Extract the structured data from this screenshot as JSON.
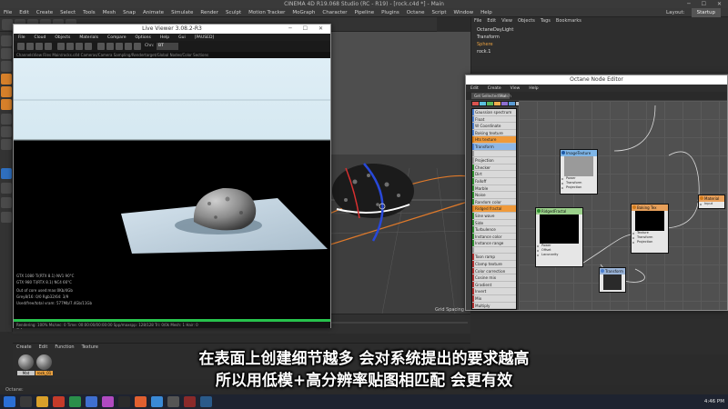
{
  "c4d": {
    "window_title": "CINEMA 4D R19.068 Studio (RC - R19) - [rock.c4d *] - Main",
    "menu": [
      "File",
      "Edit",
      "Create",
      "Select",
      "Tools",
      "Mesh",
      "Snap",
      "Animate",
      "Simulate",
      "Render",
      "Sculpt",
      "Motion Tracker",
      "MoGraph",
      "Character",
      "Pipeline",
      "Plugins",
      "Octane",
      "Script",
      "Window",
      "Help"
    ],
    "layout_label": "Layout:",
    "layout_value": "Startup",
    "object_manager": {
      "menu": [
        "File",
        "Edit",
        "View",
        "Objects",
        "Tags",
        "Bookmarks"
      ],
      "objects": [
        "OctaneDayLight",
        "Transform",
        "Sphere",
        "rock.1"
      ]
    },
    "material_manager": {
      "menu": [
        "Create",
        "Edit",
        "Function",
        "Texture"
      ],
      "materials": [
        "Mat",
        "rock_01"
      ]
    },
    "viewport_hud": "Grid Spacing : 1 m",
    "timeline_frame": "0 F",
    "status_text": "Octane:",
    "clock": "4:46 PM"
  },
  "live_viewer": {
    "title": "Live Viewer 3.08.2-R3",
    "menu": [
      "File",
      "Cloud",
      "Objects",
      "Materials",
      "Compare",
      "Options",
      "Help",
      "Gui",
      "[PAUSED]"
    ],
    "channel_label": "Chn:",
    "channel_value": "BT",
    "path_text": "ChannelsView Files Main/rocks.c4d   Cameras/Camera   Sampling/Rendertarget/Global   Nodes/Color   Sections",
    "stats": [
      "GTX 1080 Ti(RTX 8.1)     NV1    90°C",
      "GTX 980 Ti(RTX 8.1)      NC4    66°C",
      "Out of core used:max:0Kb/4Gb",
      "Grey8/16: 0/0      Rgb32/64: 3/9",
      "Used/free/total vram: 577Mb/7.4Gb/11Gb"
    ],
    "statusbar": "Rendering: 100%   Ms/sec: 0   Time: 00:00:00/00:00:00   Spp/maxspp: 128/128   Tri: 0/0k   Mesh: 1   Hair: 0",
    "progress_fraction": 1.0
  },
  "node_editor": {
    "title": "Octane Node Editor",
    "menu": [
      "Edit",
      "Create",
      "View",
      "Help"
    ],
    "get_button": "Get Sellected Mat",
    "search_label": "Search",
    "tab_colors": [
      "#d9534f",
      "#5bc0de",
      "#5cb85c",
      "#f0ad4e",
      "#8e6fd1",
      "#5a9bd5",
      "#c0c0c0",
      "#e0e0e0",
      "#aaaaaa",
      "#ffffff"
    ],
    "list_items": [
      {
        "label": "Gaussian spectrum",
        "style": "plain",
        "color": "#4a7fd1"
      },
      {
        "label": "Float",
        "style": "plain",
        "color": "#4a7fd1"
      },
      {
        "label": "W Coordinate",
        "style": "plain",
        "color": "#4a7fd1"
      },
      {
        "label": "Baking texture",
        "style": "plain",
        "color": "#4a7fd1"
      },
      {
        "label": "Hts texture",
        "style": "orange",
        "color": "#d07a1a"
      },
      {
        "label": "Transform",
        "style": "blue",
        "color": "#4a7fd1"
      },
      {
        "label": "",
        "style": "plain",
        "color": "#999999"
      },
      {
        "label": "Projection",
        "style": "plain",
        "color": "#999999"
      },
      {
        "label": "Checker",
        "style": "plain",
        "color": "#2f8f2f"
      },
      {
        "label": "Dirt",
        "style": "plain",
        "color": "#2f8f2f"
      },
      {
        "label": "Falloff",
        "style": "plain",
        "color": "#2f8f2f"
      },
      {
        "label": "Marble",
        "style": "plain",
        "color": "#2f8f2f"
      },
      {
        "label": "Noise",
        "style": "plain",
        "color": "#2f8f2f"
      },
      {
        "label": "Random color",
        "style": "plain",
        "color": "#2f8f2f"
      },
      {
        "label": "Ridged fractal",
        "style": "orange",
        "color": "#d07a1a"
      },
      {
        "label": "Sine wave",
        "style": "plain",
        "color": "#2f8f2f"
      },
      {
        "label": "Side",
        "style": "plain",
        "color": "#2f8f2f"
      },
      {
        "label": "Turbulence",
        "style": "plain",
        "color": "#2f8f2f"
      },
      {
        "label": "Instance color",
        "style": "plain",
        "color": "#2f8f2f"
      },
      {
        "label": "Instance range",
        "style": "plain",
        "color": "#2f8f2f"
      },
      {
        "label": "",
        "style": "plain",
        "color": "#999999"
      },
      {
        "label": "Toon ramp",
        "style": "plain",
        "color": "#b03030"
      },
      {
        "label": "Clamp texture",
        "style": "plain",
        "color": "#b03030"
      },
      {
        "label": "Color correction",
        "style": "plain",
        "color": "#b03030"
      },
      {
        "label": "Cosine mix",
        "style": "plain",
        "color": "#b03030"
      },
      {
        "label": "Gradient",
        "style": "plain",
        "color": "#b03030"
      },
      {
        "label": "Invert",
        "style": "plain",
        "color": "#b03030"
      },
      {
        "label": "Mix",
        "style": "plain",
        "color": "#b03030"
      },
      {
        "label": "Multiply",
        "style": "plain",
        "color": "#b03030"
      },
      {
        "label": "Add",
        "style": "plain",
        "color": "#b03030"
      }
    ],
    "nodes": {
      "image_texture": {
        "title": "ImageTexture",
        "ports": [
          "Power",
          "Transform",
          "Projection"
        ]
      },
      "ridged_fractal": {
        "title": "RidgedFractal",
        "ports": [
          "Power",
          "Offset",
          "Lacunarity",
          "Transform",
          "Projection"
        ]
      },
      "baking_tex": {
        "title": "Baking Tex",
        "ports": [
          "Texture",
          "Transform",
          "Projection"
        ]
      },
      "transform": {
        "title": "Transform"
      },
      "material": {
        "title": "Material",
        "ports": [
          "Input"
        ]
      }
    }
  },
  "subtitles": {
    "line1": "在表面上创建细节越多 会对系统提出的要求越高",
    "line2": "所以用低模+高分辨率贴图相匹配 会更有效"
  }
}
